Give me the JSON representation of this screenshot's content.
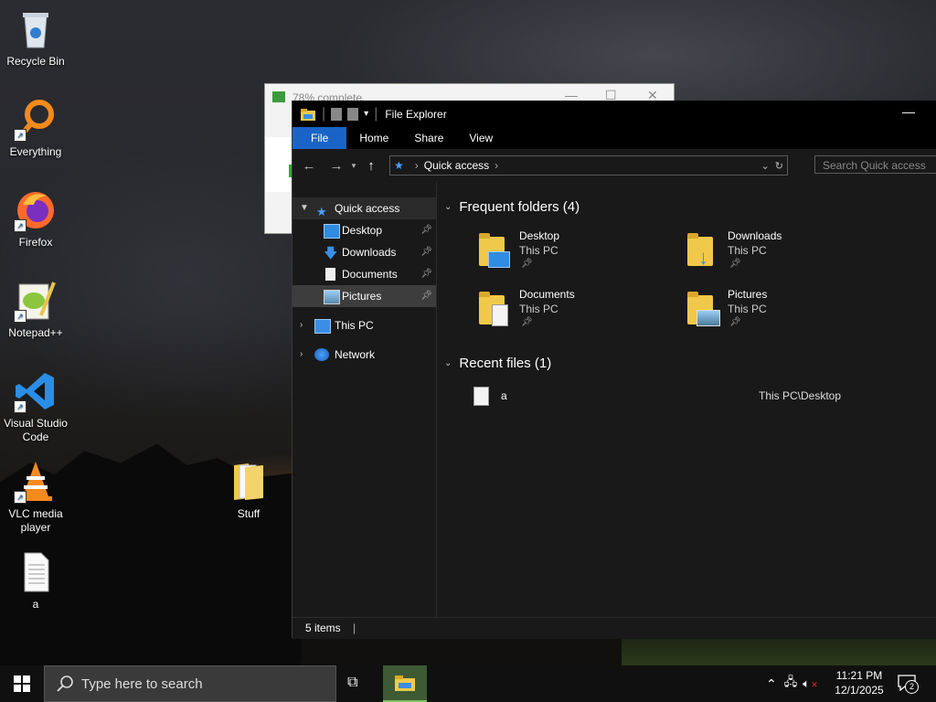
{
  "desktop": {
    "icons": [
      {
        "label": "Recycle Bin"
      },
      {
        "label": "Everything"
      },
      {
        "label": "Firefox"
      },
      {
        "label": "Notepad++"
      },
      {
        "label": "Visual Studio Code"
      },
      {
        "label": "VLC media player"
      },
      {
        "label": "a"
      },
      {
        "label": "Stuff"
      }
    ]
  },
  "bg_dialog": {
    "title": "78% complete"
  },
  "explorer": {
    "title": "File Explorer",
    "ribbon_tabs": [
      "File",
      "Home",
      "Share",
      "View"
    ],
    "address": {
      "location": "Quick access"
    },
    "search_placeholder": "Search Quick access",
    "nav": {
      "quick_access": "Quick access",
      "pinned": [
        {
          "label": "Desktop"
        },
        {
          "label": "Downloads"
        },
        {
          "label": "Documents"
        },
        {
          "label": "Pictures"
        }
      ],
      "this_pc": "This PC",
      "network": "Network"
    },
    "frequent": {
      "header": "Frequent folders (4)",
      "items": [
        {
          "name": "Desktop",
          "location": "This PC"
        },
        {
          "name": "Downloads",
          "location": "This PC"
        },
        {
          "name": "Documents",
          "location": "This PC"
        },
        {
          "name": "Pictures",
          "location": "This PC"
        }
      ]
    },
    "recent": {
      "header": "Recent files (1)",
      "items": [
        {
          "name": "a",
          "path": "This PC\\Desktop"
        }
      ]
    },
    "status": "5 items"
  },
  "taskbar": {
    "search_placeholder": "Type here to search",
    "time": "11:21 PM",
    "date": "12/1/2025",
    "notifications": "2"
  },
  "colors": {
    "accent": "#1a64c8",
    "explorer_bg": "#191919",
    "taskbar_bg": "#101010"
  }
}
